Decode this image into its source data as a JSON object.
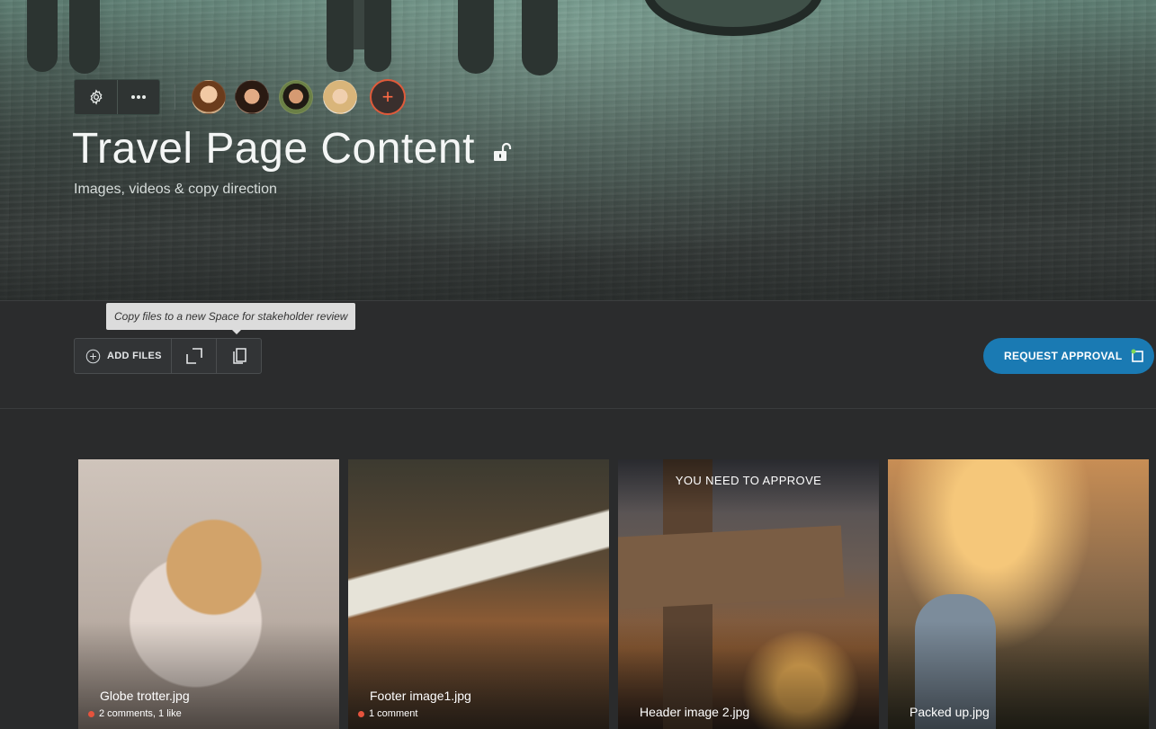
{
  "header": {
    "title": "Travel Page Content",
    "subtitle": "Images, videos & copy direction"
  },
  "toolbar": {
    "settings_icon": "gear-icon",
    "more_icon": "more-horizontal-icon",
    "add_member_label": "+"
  },
  "members": [
    {
      "name": "member-1"
    },
    {
      "name": "member-2"
    },
    {
      "name": "member-3"
    },
    {
      "name": "member-4"
    }
  ],
  "actions": {
    "tooltip": "Copy files to a new Space for stakeholder review",
    "add_files_label": "ADD FILES",
    "expand_icon": "expand-icon",
    "copy_icon": "copy-icon",
    "request_approval_label": "REQUEST APPROVAL"
  },
  "files": [
    {
      "name": "Globe trotter.jpg",
      "meta": "2 comments, 1 like",
      "banner": ""
    },
    {
      "name": "Footer image1.jpg",
      "meta": "1 comment",
      "banner": ""
    },
    {
      "name": "Header image 2.jpg",
      "meta": "",
      "banner": "YOU NEED TO APPROVE"
    },
    {
      "name": "Packed up.jpg",
      "meta": "",
      "banner": ""
    }
  ],
  "colors": {
    "accent": "#1a7ab3",
    "add_member": "#e05a3a",
    "comment_dot": "#e5533d"
  }
}
